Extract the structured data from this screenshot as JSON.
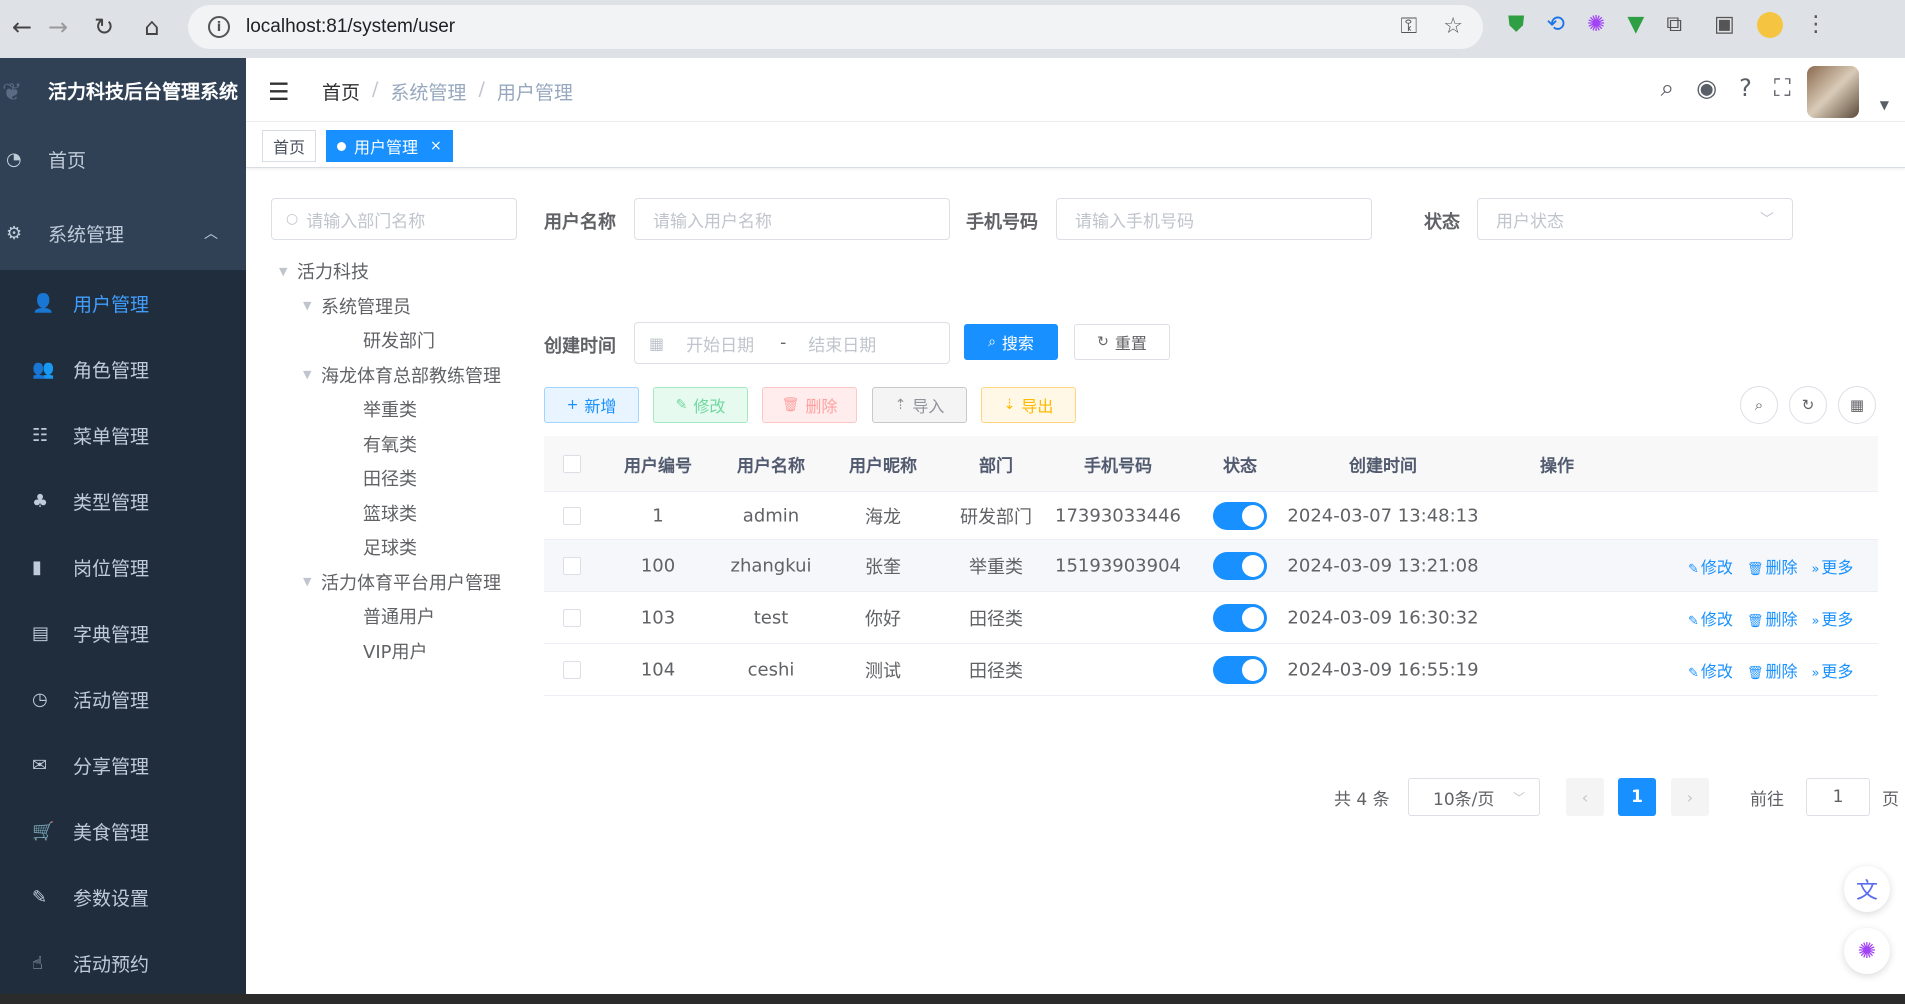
{
  "browser": {
    "url": "localhost:81/system/user",
    "icons": [
      "back-icon",
      "forward-icon",
      "reload-icon",
      "home-icon",
      "key-icon",
      "star-icon",
      "shield-extension-icon",
      "translate-extension-icon",
      "brain-extension-icon",
      "vue-extension-icon",
      "puzzle-icon",
      "sidepanel-icon",
      "profile-avatar",
      "more-icon"
    ]
  },
  "sidebar": {
    "logo": "活力科技后台管理系统",
    "home": "首页",
    "system": "系统管理",
    "items": [
      {
        "label": "用户管理",
        "icon": "user-icon",
        "active": true
      },
      {
        "label": "角色管理",
        "icon": "peoples-icon"
      },
      {
        "label": "菜单管理",
        "icon": "tree-table-icon"
      },
      {
        "label": "类型管理",
        "icon": "tree-icon"
      },
      {
        "label": "岗位管理",
        "icon": "post-icon"
      },
      {
        "label": "字典管理",
        "icon": "dict-icon"
      },
      {
        "label": "活动管理",
        "icon": "clock-icon"
      },
      {
        "label": "分享管理",
        "icon": "message-icon"
      },
      {
        "label": "美食管理",
        "icon": "cart-icon"
      },
      {
        "label": "参数设置",
        "icon": "edit-icon"
      },
      {
        "label": "活动预约",
        "icon": "hand-icon"
      }
    ]
  },
  "header": {
    "breadcrumb": [
      "首页",
      "系统管理",
      "用户管理"
    ],
    "sep": "/"
  },
  "tags": {
    "home": "首页",
    "active": "用户管理",
    "close": "×"
  },
  "dept": {
    "placeholder": "请输入部门名称",
    "tree": [
      {
        "label": "活力科技",
        "level": 0,
        "expanded": true
      },
      {
        "label": "系统管理员",
        "level": 1,
        "expanded": true
      },
      {
        "label": "研发部门",
        "level": 2
      },
      {
        "label": "海龙体育总部教练管理",
        "level": 1,
        "expanded": true
      },
      {
        "label": "举重类",
        "level": 2
      },
      {
        "label": "有氧类",
        "level": 2
      },
      {
        "label": "田径类",
        "level": 2
      },
      {
        "label": "篮球类",
        "level": 2
      },
      {
        "label": "足球类",
        "level": 2
      },
      {
        "label": "活力体育平台用户管理",
        "level": 1,
        "expanded": true
      },
      {
        "label": "普通用户",
        "level": 2
      },
      {
        "label": "VIP用户",
        "level": 2
      }
    ]
  },
  "query": {
    "username_label": "用户名称",
    "username_placeholder": "请输入用户名称",
    "phone_label": "手机号码",
    "phone_placeholder": "请输入手机号码",
    "status_label": "状态",
    "status_placeholder": "用户状态",
    "time_label": "创建时间",
    "start_placeholder": "开始日期",
    "end_placeholder": "结束日期",
    "range_sep": "-",
    "search": "搜索",
    "reset": "重置"
  },
  "toolbar": {
    "add": "新增",
    "edit": "修改",
    "delete": "删除",
    "import": "导入",
    "export": "导出"
  },
  "table": {
    "columns": [
      "用户编号",
      "用户名称",
      "用户昵称",
      "部门",
      "手机号码",
      "状态",
      "创建时间",
      "操作"
    ],
    "rows": [
      {
        "id": "1",
        "name": "admin",
        "nick": "海龙",
        "dept": "研发部门",
        "phone": "17393033446",
        "status": true,
        "time": "2024-03-07 13:48:13",
        "ops": false
      },
      {
        "id": "100",
        "name": "zhangkui",
        "nick": "张奎",
        "dept": "举重类",
        "phone": "15193903904",
        "status": true,
        "time": "2024-03-09 13:21:08",
        "ops": true
      },
      {
        "id": "103",
        "name": "test",
        "nick": "你好",
        "dept": "田径类",
        "phone": "",
        "status": true,
        "time": "2024-03-09 16:30:32",
        "ops": true
      },
      {
        "id": "104",
        "name": "ceshi",
        "nick": "测试",
        "dept": "田径类",
        "phone": "",
        "status": true,
        "time": "2024-03-09 16:55:19",
        "ops": true
      }
    ],
    "op_edit": "修改",
    "op_delete": "删除",
    "op_more": "更多"
  },
  "pagination": {
    "total": "共 4 条",
    "size": "10条/页",
    "current": "1",
    "goto": "前往",
    "goto_value": "1",
    "page_unit": "页"
  },
  "colors": {
    "primary": "#1890ff",
    "sidebar_bg": "#304156",
    "sidebar_sub_bg": "#1f2d3d"
  }
}
